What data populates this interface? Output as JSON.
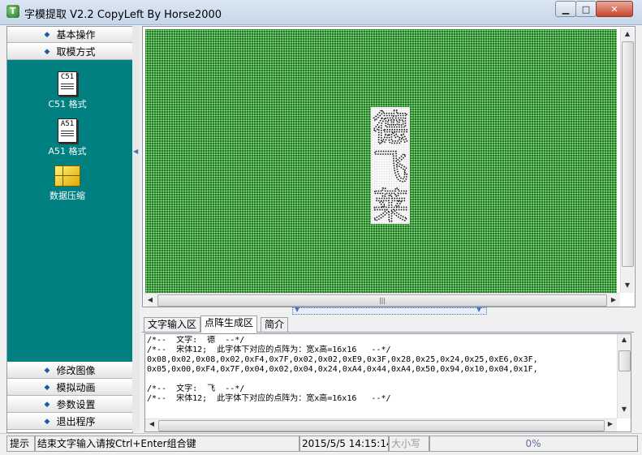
{
  "window": {
    "title": "字模提取 V2.2  CopyLeft By Horse2000",
    "icon": "app-icon"
  },
  "nav": {
    "top_items": [
      "基本操作",
      "取模方式"
    ],
    "bottom_items": [
      "修改图像",
      "模拟动画",
      "参数设置",
      "退出程序"
    ]
  },
  "tools": [
    {
      "label": "C51 格式",
      "icon_text": "C51",
      "icon": "c51-doc-icon"
    },
    {
      "label": "A51 格式",
      "icon_text": "A51",
      "icon": "a51-doc-icon"
    },
    {
      "label": "数据压缩",
      "icon": "compress-box-icon"
    }
  ],
  "canvas": {
    "characters": [
      "德",
      "飞",
      "莱"
    ],
    "grid_color": "#0a7a0a"
  },
  "tabs": [
    "文字输入区",
    "点阵生成区",
    "简介"
  ],
  "active_tab": "点阵生成区",
  "output": {
    "lines": [
      "/*--  文字:  德  --*/",
      "/*--  宋体12;  此字体下对应的点阵为：宽x高=16x16   --*/",
      "0x08,0x02,0x08,0x02,0xF4,0x7F,0x02,0x02,0xE9,0x3F,0x28,0x25,0x24,0x25,0xE6,0x3F,",
      "0x05,0x00,0xF4,0x7F,0x04,0x02,0x04,0x24,0xA4,0x44,0xA4,0x50,0x94,0x10,0x04,0x1F,",
      "",
      "/*--  文字:  飞  --*/",
      "/*--  宋体12;  此字体下对应的点阵为：宽x高=16x16   --*/"
    ]
  },
  "status": {
    "hint": "提示",
    "message": "结束文字输入请按Ctrl+Enter组合键",
    "time": "2015/5/5 14:15:14",
    "caps": "大小写",
    "progress": "0%"
  }
}
